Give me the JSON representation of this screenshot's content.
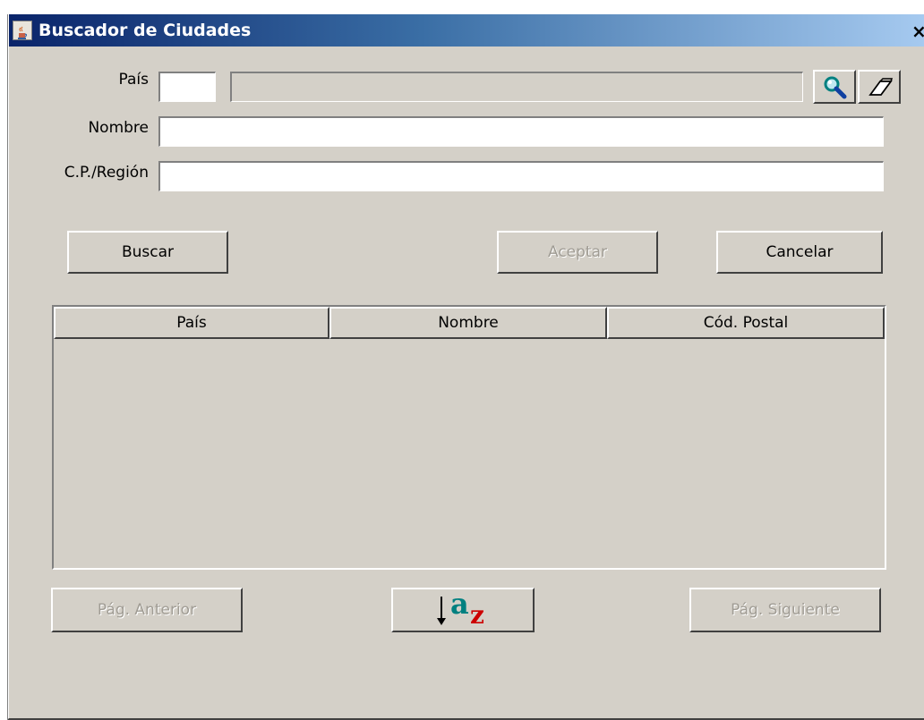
{
  "window": {
    "title": "Buscador de Ciudades",
    "close_glyph": "×",
    "app_icon": "java-cup-icon"
  },
  "form": {
    "pais_label": "País",
    "pais_code_value": "",
    "pais_name_value": "",
    "nombre_label": "Nombre",
    "nombre_value": "",
    "cp_label": "C.P./Región",
    "cp_value": ""
  },
  "icons": {
    "search": "magnifier-icon",
    "clear": "eraser-icon",
    "sort": "sort-az-icon"
  },
  "buttons": {
    "buscar": "Buscar",
    "aceptar": "Aceptar",
    "cancelar": "Cancelar",
    "prev": "Pág. Anterior",
    "next": "Pág. Siguiente"
  },
  "table": {
    "columns": [
      "País",
      "Nombre",
      "Cód. Postal"
    ],
    "rows": []
  },
  "sort_icon": {
    "letter_top": "a",
    "letter_bottom": "z",
    "color_top": "#008080",
    "color_bottom": "#cc0000"
  },
  "colors": {
    "face": "#d4d0c8",
    "title_start": "#0a246a",
    "title_end": "#a6caf0",
    "disabled_text": "#a09c94"
  }
}
